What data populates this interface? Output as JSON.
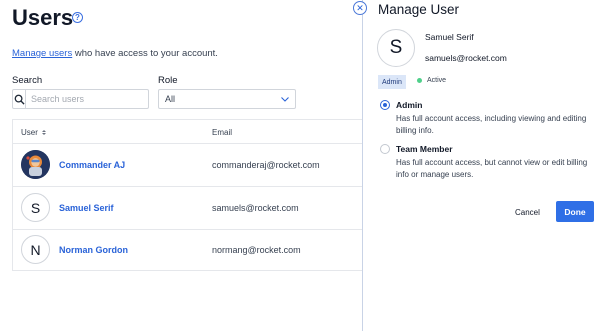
{
  "page": {
    "title": "Users",
    "intro_link": "Manage users",
    "intro_rest": " who have access to your account."
  },
  "filters": {
    "search_label": "Search",
    "search_placeholder": "Search users",
    "role_label": "Role",
    "role_value": "All"
  },
  "table": {
    "columns": [
      "User",
      "Email"
    ],
    "rows": [
      {
        "name": "Commander AJ",
        "email": "commanderaj@rocket.com",
        "avatar": "photo"
      },
      {
        "name": "Samuel Serif",
        "email": "samuels@rocket.com",
        "avatar": "S"
      },
      {
        "name": "Norman Gordon",
        "email": "normang@rocket.com",
        "avatar": "N"
      }
    ]
  },
  "drawer": {
    "title": "Manage User",
    "avatar": "S",
    "name": "Samuel Serif",
    "email": "samuels@rocket.com",
    "role_badge": "Admin",
    "status": "Active",
    "options": [
      {
        "title": "Admin",
        "description": "Has full account access, including viewing and editing billing info.",
        "selected": true
      },
      {
        "title": "Team Member",
        "description": "Has full account access, but cannot view or edit billing info or manage users.",
        "selected": false
      }
    ],
    "cancel_label": "Cancel",
    "done_label": "Done"
  },
  "icons": [
    "help-icon",
    "search-icon",
    "chevron-down-icon",
    "sort-icon",
    "close-icon"
  ],
  "colors": {
    "accent": "#2f6fe6",
    "link": "#2a63d8",
    "status_active": "#4fd08a",
    "badge_bg": "#dbe6f8"
  }
}
